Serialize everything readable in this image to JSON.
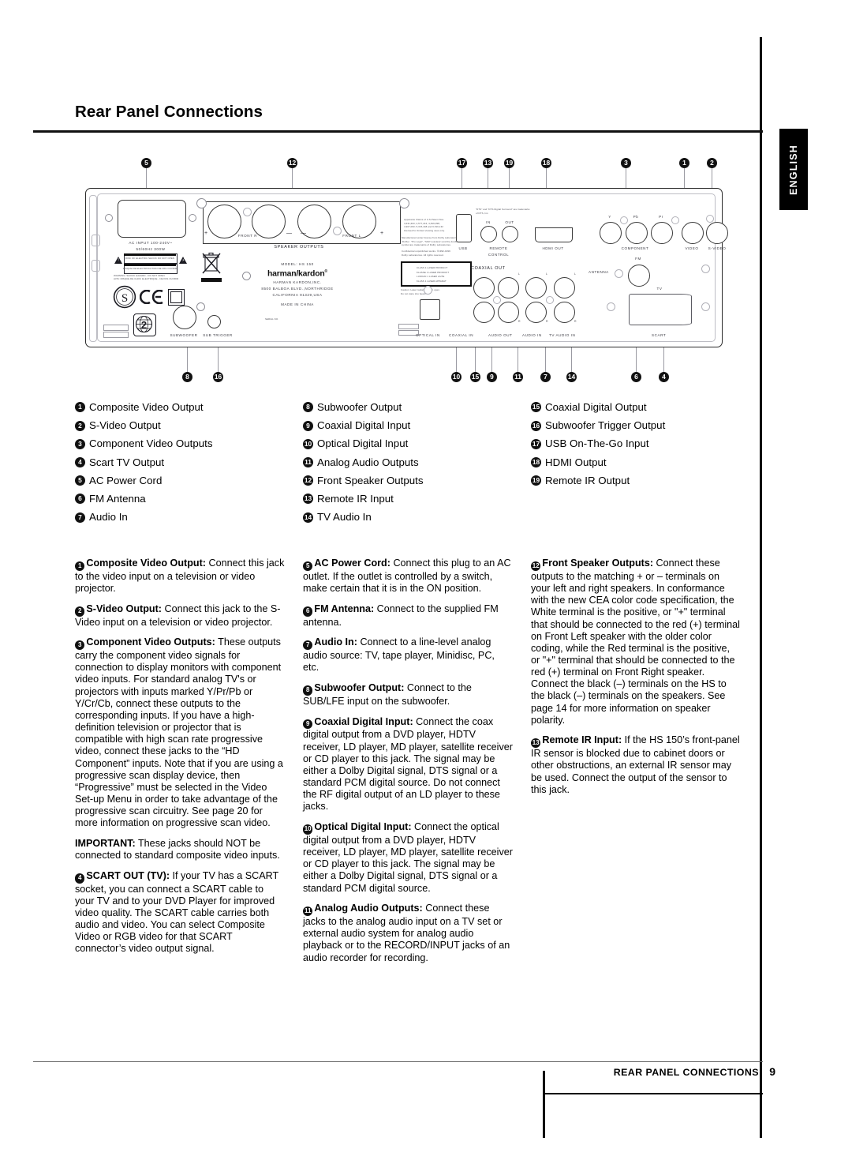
{
  "header": {
    "title": "Rear Panel Connections",
    "language_tab": "ENGLISH"
  },
  "footer": {
    "section": "REAR PANEL CONNECTIONS",
    "page_number": "9"
  },
  "diagram": {
    "callouts_top": [
      "5",
      "12",
      "17",
      "13",
      "19",
      "18",
      "3",
      "1",
      "2"
    ],
    "callouts_bottom": [
      "8",
      "16",
      "10",
      "15",
      "9",
      "11",
      "7",
      "14",
      "6",
      "4"
    ],
    "panel_labels": {
      "ac_input_line1": "AC  INPUT 100-240V~",
      "ac_input_line2": "50/60Hz 300W",
      "caution_title": "CAUTION",
      "caution_body": "RISK OF ELECTRIC SHOCK DO NOT OPEN",
      "attention_title": "ATTENTION",
      "attention_body": "RISQUE DE  ELECTROCUTION NE PAS OUVRIR",
      "warning_line1": "WARNING: SHOCK HAZARD - DO NOT OPEN",
      "warning_line2": "AVIS: RISQUE DE CHOC ELECTRIQUE - NE PAS OUVRIR",
      "region_code": "2",
      "subwoofer": "SUBWOOFER",
      "sub_trigger": "SUB TRIGGER",
      "front_r": "FRONT R",
      "front_l": "FRONT L",
      "speaker_outputs": "SPEAKER OUTPUTS",
      "plus_left": "+",
      "minus_1": "—",
      "minus_2": "—",
      "plus_right": "+",
      "model": "MODEL: HS 150",
      "brand": "harman/kardon",
      "brand_reg": "®",
      "company": "HARMAN KARDON,INC.",
      "address1": "8500 BALBOA BLVD.,NORTHRIDGE",
      "address2": "CALIFORNIA 91329,USA",
      "made_in": "MADE IN CHINA",
      "serial": "SERIAL NO.",
      "patent1": "Apparatus Claims of U.S.Patent Nos.",
      "patent2": "4,631,603; 4,577,216; 4,819,098;",
      "patent3": "4,907,093; 5,315,448  and 6,516,132",
      "patent4": "licensed for limited viewing uses only.",
      "dolby1": "Manufactured under license from Dolby Laboratories.",
      "dolby2": "\"Dolby\", \"Pro Logic\", \"MLP Lossless\",and the double-D",
      "dolby3": "symbol are trademarks of Dolby Laboratories.",
      "dolby4": "Confidential unpublished works. ©1992-1999",
      "dolby5": "Dolby Laboratories. All rights reserved.",
      "dts1": "\"DTS\" and \"DTS Digital Surround\" are trademarks",
      "dts2": "of DTS, Inc.",
      "laser1": "CLASS 1 LASER PRODUCT",
      "laser2": "KLASSE 1 LASER PRODUKT",
      "laser3": "LUOKAN 1 LASER LAITE",
      "laser4": "KLASS 1 LASER APPARAT",
      "laser_caution1": "Caution: Laser radiation when open.",
      "laser_caution2": "Do not stare into beam.",
      "usb": "USB",
      "remote_in": "IN",
      "remote_out": "OUT",
      "remote_control1": "REMOTE",
      "remote_control2": "CONTROL",
      "hdmi_out": "HDMI  OUT",
      "component": "COMPONENT",
      "comp_y": "Y",
      "comp_pb": "Pb",
      "comp_pr": "Pr",
      "video": "VIDEO",
      "s_video": "S-VIDEO",
      "fm": "FM",
      "antenna": "ANTENNA",
      "tv": "TV",
      "scart": "SCART",
      "optical_in": "OPTICAL IN",
      "coaxial_in": "COAXIAL IN",
      "coaxial_out": "COAXIAL OUT",
      "audio_out": "AUDIO OUT",
      "audio_in": "AUDIO IN",
      "tv_audio_in": "TV AUDIO IN",
      "ch_l": "L",
      "ch_r": "R"
    }
  },
  "legend": {
    "col1": [
      {
        "num": "1",
        "label": "Composite Video Output"
      },
      {
        "num": "2",
        "label": "S-Video Output"
      },
      {
        "num": "3",
        "label": "Component Video Outputs"
      },
      {
        "num": "4",
        "label": "Scart TV Output"
      },
      {
        "num": "5",
        "label": "AC Power Cord"
      },
      {
        "num": "6",
        "label": "FM Antenna"
      },
      {
        "num": "7",
        "label": "Audio In"
      }
    ],
    "col2": [
      {
        "num": "8",
        "label": "Subwoofer Output"
      },
      {
        "num": "9",
        "label": "Coaxial Digital Input"
      },
      {
        "num": "10",
        "label": "Optical Digital Input"
      },
      {
        "num": "11",
        "label": "Analog Audio Outputs"
      },
      {
        "num": "12",
        "label": "Front Speaker Outputs"
      },
      {
        "num": "13",
        "label": "Remote IR Input"
      },
      {
        "num": "14",
        "label": "TV Audio In"
      }
    ],
    "col3": [
      {
        "num": "15",
        "label": "Coaxial Digital Output"
      },
      {
        "num": "16",
        "label": "Subwoofer Trigger Output"
      },
      {
        "num": "17",
        "label": "USB On-The-Go Input"
      },
      {
        "num": "18",
        "label": "HDMI Output"
      },
      {
        "num": "19",
        "label": "Remote IR Output"
      }
    ]
  },
  "body": {
    "col1": [
      {
        "num": "1",
        "title": "Composite Video Output:",
        "text": " Connect this jack to the video input on a television or video projector."
      },
      {
        "num": "2",
        "title": "S-Video Output:",
        "text": " Connect this jack to the S-Video input on a television or video projector."
      },
      {
        "num": "3",
        "title": "Component Video Outputs:",
        "text": " These outputs carry the component video signals for connection to display monitors with component video inputs. For standard analog TV's or projectors with inputs marked Y/Pr/Pb or Y/Cr/Cb, connect these outputs to the corresponding inputs. If you have a high-definition television or projector that is compatible with high scan rate progressive video, connect these jacks to the “HD Component” inputs. Note that if you are using a progressive scan display device, then “Progressive” must be selected in the Video Set-up Menu in order to take advantage of the progressive scan circuitry. See page 20 for more information on progressive scan video."
      },
      {
        "num": "",
        "title": "IMPORTANT:",
        "text": " These jacks should NOT be connected to standard composite video inputs."
      },
      {
        "num": "4",
        "title": "SCART OUT (TV):",
        "text": " If your TV has a SCART socket, you can connect a SCART cable to your TV and to your DVD Player for improved video quality. The SCART cable carries both audio and video. You can select Composite Video or RGB video for that SCART connector’s video output signal."
      }
    ],
    "col2": [
      {
        "num": "5",
        "title": "AC Power Cord:",
        "text": " Connect this plug to an AC outlet. If the outlet is controlled by a switch, make certain that it is in the ON position."
      },
      {
        "num": "6",
        "title": "FM Antenna:",
        "text": " Connect to the supplied FM antenna."
      },
      {
        "num": "7",
        "title": "Audio In:",
        "text": " Connect to a line-level analog audio source: TV, tape player, Minidisc, PC, etc."
      },
      {
        "num": "8",
        "title": "Subwoofer Output:",
        "text": " Connect to the SUB/LFE input on the subwoofer."
      },
      {
        "num": "9",
        "title": "Coaxial Digital Input:",
        "text": " Connect the coax digital output from a DVD player, HDTV receiver, LD player, MD player, satellite receiver or CD player to this jack. The signal may be either a Dolby Digital signal, DTS signal or a standard PCM digital source. Do not connect the RF digital output of an LD player to these jacks."
      },
      {
        "num": "10",
        "title": "Optical Digital Input:",
        "text": " Connect the optical digital output from a DVD player, HDTV receiver, LD player, MD player, satellite receiver or CD player to this jack. The signal may be either a Dolby Digital signal, DTS signal or a standard PCM digital source."
      },
      {
        "num": "11",
        "title": "Analog Audio Outputs:",
        "text": " Connect these jacks to the analog audio input on a TV set or external audio system for analog audio playback or to the RECORD/INPUT jacks of an audio recorder for recording."
      }
    ],
    "col3": [
      {
        "num": "12",
        "title": "Front Speaker Outputs:",
        "text": " Connect these outputs to the matching + or – terminals on your left and right speakers. In conformance with the new CEA color code specification, the White terminal is the positive, or \"+\" terminal that should be connected to the red (+) terminal on Front Left speaker with the older color coding, while the Red terminal is the positive, or \"+\" terminal that should be connected to the red (+) terminal on Front Right speaker. Connect the black (–) terminals on the HS to the black (–) terminals on the speakers. See page 14 for more information on speaker polarity."
      },
      {
        "num": "13",
        "title": "Remote IR Input:",
        "text": " If the HS 150’s front-panel IR sensor is blocked due to cabinet doors or other obstructions, an external IR sensor may be used. Connect the output of the sensor to this jack."
      }
    ]
  }
}
